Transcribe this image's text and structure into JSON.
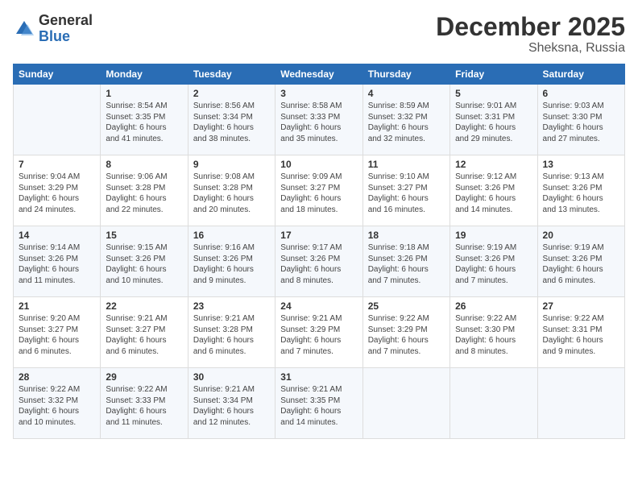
{
  "logo": {
    "general": "General",
    "blue": "Blue"
  },
  "title": "December 2025",
  "location": "Sheksna, Russia",
  "days_of_week": [
    "Sunday",
    "Monday",
    "Tuesday",
    "Wednesday",
    "Thursday",
    "Friday",
    "Saturday"
  ],
  "weeks": [
    [
      {
        "day": "",
        "info": ""
      },
      {
        "day": "1",
        "info": "Sunrise: 8:54 AM\nSunset: 3:35 PM\nDaylight: 6 hours\nand 41 minutes."
      },
      {
        "day": "2",
        "info": "Sunrise: 8:56 AM\nSunset: 3:34 PM\nDaylight: 6 hours\nand 38 minutes."
      },
      {
        "day": "3",
        "info": "Sunrise: 8:58 AM\nSunset: 3:33 PM\nDaylight: 6 hours\nand 35 minutes."
      },
      {
        "day": "4",
        "info": "Sunrise: 8:59 AM\nSunset: 3:32 PM\nDaylight: 6 hours\nand 32 minutes."
      },
      {
        "day": "5",
        "info": "Sunrise: 9:01 AM\nSunset: 3:31 PM\nDaylight: 6 hours\nand 29 minutes."
      },
      {
        "day": "6",
        "info": "Sunrise: 9:03 AM\nSunset: 3:30 PM\nDaylight: 6 hours\nand 27 minutes."
      }
    ],
    [
      {
        "day": "7",
        "info": "Sunrise: 9:04 AM\nSunset: 3:29 PM\nDaylight: 6 hours\nand 24 minutes."
      },
      {
        "day": "8",
        "info": "Sunrise: 9:06 AM\nSunset: 3:28 PM\nDaylight: 6 hours\nand 22 minutes."
      },
      {
        "day": "9",
        "info": "Sunrise: 9:08 AM\nSunset: 3:28 PM\nDaylight: 6 hours\nand 20 minutes."
      },
      {
        "day": "10",
        "info": "Sunrise: 9:09 AM\nSunset: 3:27 PM\nDaylight: 6 hours\nand 18 minutes."
      },
      {
        "day": "11",
        "info": "Sunrise: 9:10 AM\nSunset: 3:27 PM\nDaylight: 6 hours\nand 16 minutes."
      },
      {
        "day": "12",
        "info": "Sunrise: 9:12 AM\nSunset: 3:26 PM\nDaylight: 6 hours\nand 14 minutes."
      },
      {
        "day": "13",
        "info": "Sunrise: 9:13 AM\nSunset: 3:26 PM\nDaylight: 6 hours\nand 13 minutes."
      }
    ],
    [
      {
        "day": "14",
        "info": "Sunrise: 9:14 AM\nSunset: 3:26 PM\nDaylight: 6 hours\nand 11 minutes."
      },
      {
        "day": "15",
        "info": "Sunrise: 9:15 AM\nSunset: 3:26 PM\nDaylight: 6 hours\nand 10 minutes."
      },
      {
        "day": "16",
        "info": "Sunrise: 9:16 AM\nSunset: 3:26 PM\nDaylight: 6 hours\nand 9 minutes."
      },
      {
        "day": "17",
        "info": "Sunrise: 9:17 AM\nSunset: 3:26 PM\nDaylight: 6 hours\nand 8 minutes."
      },
      {
        "day": "18",
        "info": "Sunrise: 9:18 AM\nSunset: 3:26 PM\nDaylight: 6 hours\nand 7 minutes."
      },
      {
        "day": "19",
        "info": "Sunrise: 9:19 AM\nSunset: 3:26 PM\nDaylight: 6 hours\nand 7 minutes."
      },
      {
        "day": "20",
        "info": "Sunrise: 9:19 AM\nSunset: 3:26 PM\nDaylight: 6 hours\nand 6 minutes."
      }
    ],
    [
      {
        "day": "21",
        "info": "Sunrise: 9:20 AM\nSunset: 3:27 PM\nDaylight: 6 hours\nand 6 minutes."
      },
      {
        "day": "22",
        "info": "Sunrise: 9:21 AM\nSunset: 3:27 PM\nDaylight: 6 hours\nand 6 minutes."
      },
      {
        "day": "23",
        "info": "Sunrise: 9:21 AM\nSunset: 3:28 PM\nDaylight: 6 hours\nand 6 minutes."
      },
      {
        "day": "24",
        "info": "Sunrise: 9:21 AM\nSunset: 3:29 PM\nDaylight: 6 hours\nand 7 minutes."
      },
      {
        "day": "25",
        "info": "Sunrise: 9:22 AM\nSunset: 3:29 PM\nDaylight: 6 hours\nand 7 minutes."
      },
      {
        "day": "26",
        "info": "Sunrise: 9:22 AM\nSunset: 3:30 PM\nDaylight: 6 hours\nand 8 minutes."
      },
      {
        "day": "27",
        "info": "Sunrise: 9:22 AM\nSunset: 3:31 PM\nDaylight: 6 hours\nand 9 minutes."
      }
    ],
    [
      {
        "day": "28",
        "info": "Sunrise: 9:22 AM\nSunset: 3:32 PM\nDaylight: 6 hours\nand 10 minutes."
      },
      {
        "day": "29",
        "info": "Sunrise: 9:22 AM\nSunset: 3:33 PM\nDaylight: 6 hours\nand 11 minutes."
      },
      {
        "day": "30",
        "info": "Sunrise: 9:21 AM\nSunset: 3:34 PM\nDaylight: 6 hours\nand 12 minutes."
      },
      {
        "day": "31",
        "info": "Sunrise: 9:21 AM\nSunset: 3:35 PM\nDaylight: 6 hours\nand 14 minutes."
      },
      {
        "day": "",
        "info": ""
      },
      {
        "day": "",
        "info": ""
      },
      {
        "day": "",
        "info": ""
      }
    ]
  ]
}
